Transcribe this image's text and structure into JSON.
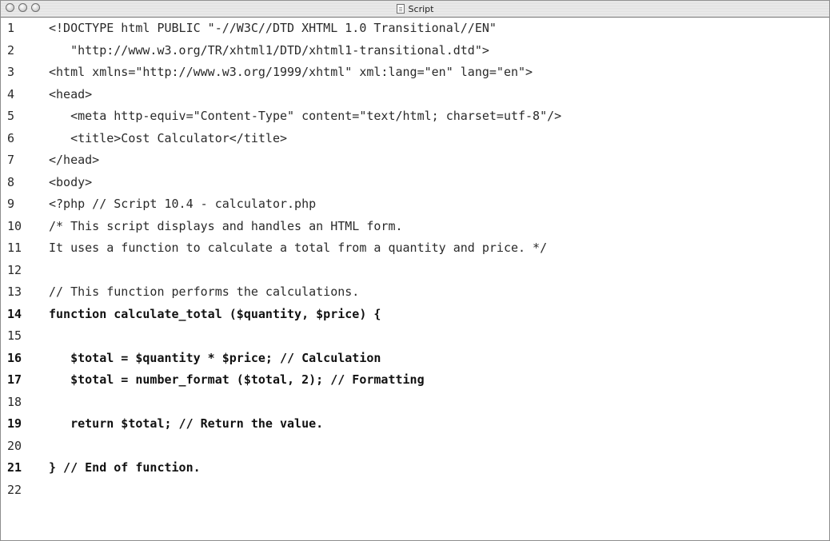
{
  "window": {
    "title": "Script"
  },
  "lines": [
    {
      "number": "1",
      "text": "<!DOCTYPE html PUBLIC \"-//W3C//DTD XHTML 1.0 Transitional//EN\"",
      "bold": false
    },
    {
      "number": "2",
      "text": "   \"http://www.w3.org/TR/xhtml1/DTD/xhtml1-transitional.dtd\">",
      "bold": false
    },
    {
      "number": "3",
      "text": "<html xmlns=\"http://www.w3.org/1999/xhtml\" xml:lang=\"en\" lang=\"en\">",
      "bold": false
    },
    {
      "number": "4",
      "text": "<head>",
      "bold": false
    },
    {
      "number": "5",
      "text": "   <meta http-equiv=\"Content-Type\" content=\"text/html; charset=utf-8\"/>",
      "bold": false
    },
    {
      "number": "6",
      "text": "   <title>Cost Calculator</title>",
      "bold": false
    },
    {
      "number": "7",
      "text": "</head>",
      "bold": false
    },
    {
      "number": "8",
      "text": "<body>",
      "bold": false
    },
    {
      "number": "9",
      "text": "<?php // Script 10.4 - calculator.php",
      "bold": false
    },
    {
      "number": "10",
      "text": "/* This script displays and handles an HTML form.",
      "bold": false
    },
    {
      "number": "11",
      "text": "It uses a function to calculate a total from a quantity and price. */",
      "bold": false
    },
    {
      "number": "12",
      "text": "",
      "bold": false
    },
    {
      "number": "13",
      "text": "// This function performs the calculations.",
      "bold": false
    },
    {
      "number": "14",
      "text": "function calculate_total ($quantity, $price) {",
      "bold": true
    },
    {
      "number": "15",
      "text": "",
      "bold": false
    },
    {
      "number": "16",
      "text": "   $total = $quantity * $price; // Calculation",
      "bold": true
    },
    {
      "number": "17",
      "text": "   $total = number_format ($total, 2); // Formatting",
      "bold": true
    },
    {
      "number": "18",
      "text": "",
      "bold": false
    },
    {
      "number": "19",
      "text": "   return $total; // Return the value.",
      "bold": true
    },
    {
      "number": "20",
      "text": "",
      "bold": false
    },
    {
      "number": "21",
      "text": "} // End of function.",
      "bold": true
    },
    {
      "number": "22",
      "text": "",
      "bold": false
    }
  ]
}
